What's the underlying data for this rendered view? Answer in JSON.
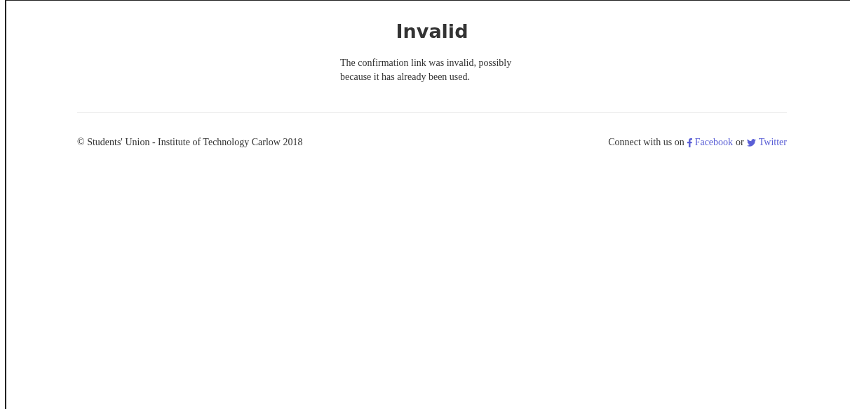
{
  "heading": "Invalid",
  "message": "The confirmation link was invalid, possibly because it has already been used.",
  "footer": {
    "copyright": "© Students' Union - Institute of Technology Carlow 2018",
    "connect_text": "Connect with us on",
    "links": [
      {
        "kind": "facebook",
        "label": "Facebook"
      },
      {
        "kind": "twitter",
        "label": "Twitter"
      }
    ],
    "separator": "or"
  }
}
